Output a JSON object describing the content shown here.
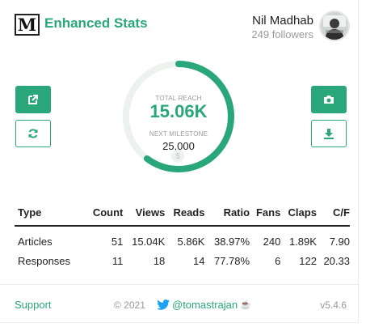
{
  "header": {
    "logo_letter": "M",
    "title": "Enhanced Stats",
    "user_name": "Nil Madhab",
    "followers": "249 followers"
  },
  "buttons": {
    "left_top_icon": "external-link-icon",
    "left_bottom_icon": "refresh-icon",
    "right_top_icon": "camera-icon",
    "right_bottom_icon": "download-icon"
  },
  "gauge": {
    "reach_label": "TOTAL REACH",
    "reach_value": "15.06K",
    "milestone_label": "NEXT MILESTONE",
    "milestone_value": "25,000",
    "progress_fraction": 0.6024,
    "milestone_icon": "dollar-icon"
  },
  "table": {
    "headers": [
      "Type",
      "Count",
      "Views",
      "Reads",
      "Ratio",
      "Fans",
      "Claps",
      "C/F"
    ],
    "rows": [
      [
        "Articles",
        "51",
        "15.04K",
        "5.86K",
        "38.97%",
        "240",
        "1.89K",
        "7.90"
      ],
      [
        "Responses",
        "11",
        "18",
        "14",
        "77.78%",
        "6",
        "122",
        "20.33"
      ]
    ]
  },
  "footer": {
    "support": "Support",
    "copyright": "© 2021",
    "twitter_handle": "@tomastrajan",
    "twitter_icon": "twitter-bird-icon",
    "coffee_icon": "coffee-icon",
    "version": "v5.4.6"
  },
  "colors": {
    "accent": "#2aa77a",
    "track": "#eef2ef",
    "muted": "#999999"
  }
}
